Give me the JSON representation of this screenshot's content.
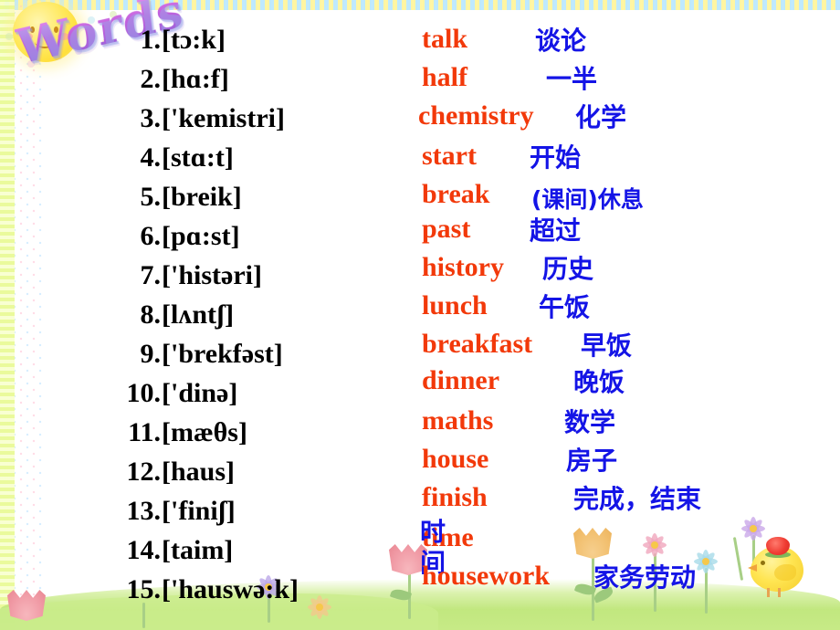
{
  "slide": {
    "title": "Words",
    "decorations": {
      "sun": "sun-smiley-icon",
      "chick": "chick-icon",
      "strawberry_hat": "strawberry-icon",
      "flowers": "flowers-icon",
      "grass": "grass-band"
    },
    "colors": {
      "english": "#F2390A",
      "chinese": "#1414E6",
      "phonetic": "#000000",
      "title_gradient_from": "#E79CF2",
      "title_gradient_to": "#8E63D8",
      "grass": "#C4E980",
      "sun": "#FFE55C"
    }
  },
  "entries": [
    {
      "num": "1.",
      "ipa": "[tɔ:k]",
      "en": "talk",
      "zh": "谈论"
    },
    {
      "num": "2.",
      "ipa": "[hɑ:f]",
      "en": "half",
      "zh": "一半"
    },
    {
      "num": "3.",
      "ipa": "['kemistri]",
      "en": "chemistry",
      "zh": "化学"
    },
    {
      "num": "4.",
      "ipa": "[stɑ:t]",
      "en": "start",
      "zh": "开始"
    },
    {
      "num": "5.",
      "ipa": "[breik]",
      "en": "break",
      "zh": "(课间)休息"
    },
    {
      "num": "6.",
      "ipa": "[pɑ:st]",
      "en": "past",
      "zh": "超过"
    },
    {
      "num": "7.",
      "ipa": "['histəri]",
      "en": "history",
      "zh": "历史"
    },
    {
      "num": "8.",
      "ipa": "[lʌntʃ]",
      "en": "lunch",
      "zh": "午饭"
    },
    {
      "num": "9.",
      "ipa": "['brekfəst]",
      "en": "breakfast",
      "zh": "早饭"
    },
    {
      "num": "10.",
      "ipa": "['dinə]",
      "en": "dinner",
      "zh": "晚饭"
    },
    {
      "num": "11.",
      "ipa": "[mæθs]",
      "en": "maths",
      "zh": "数学"
    },
    {
      "num": "12.",
      "ipa": "[haus]",
      "en": "house",
      "zh": "房子"
    },
    {
      "num": "13.",
      "ipa": "['finiʃ]",
      "en": "finish",
      "zh": "完成，结束"
    },
    {
      "num": "14.",
      "ipa": "[taim]",
      "en": "time",
      "zh": "时间"
    },
    {
      "num": "15.",
      "ipa": "['hauswə:k]",
      "en": "housework",
      "zh": "家务劳动"
    }
  ]
}
